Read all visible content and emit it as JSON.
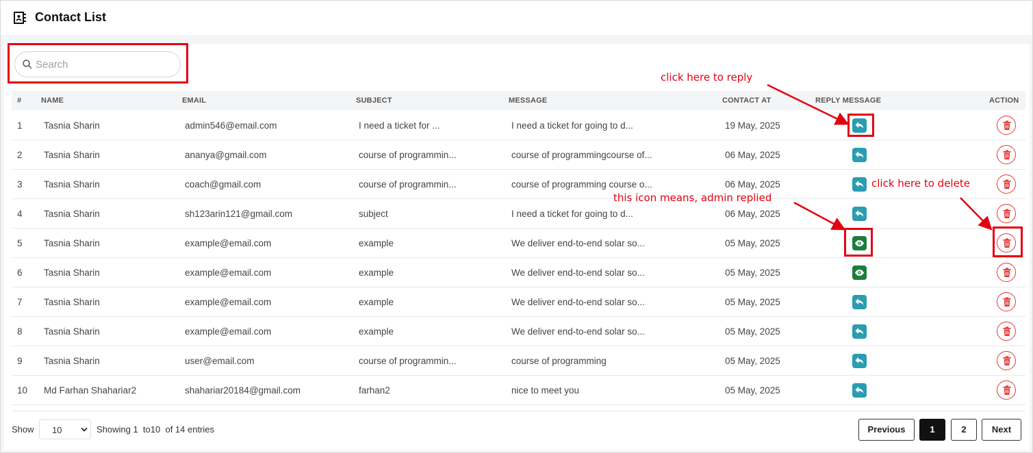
{
  "header": {
    "title": "Contact List",
    "icon": "address-book-icon"
  },
  "search": {
    "placeholder": "Search",
    "value": ""
  },
  "table": {
    "columns": {
      "index": "#",
      "name": "NAME",
      "email": "EMAIL",
      "subject": "SUBJECT",
      "message": "MESSAGE",
      "contact_at": "CONTACT AT",
      "reply": "REPLY MESSAGE",
      "action": "ACTION"
    },
    "rows": [
      {
        "index": "1",
        "name": "Tasnia Sharin",
        "email": "admin546@email.com",
        "subject": "I need a ticket for ...",
        "message": "I need a ticket for going to d...",
        "contact_at": "19 May, 2025",
        "replied": false
      },
      {
        "index": "2",
        "name": "Tasnia Sharin",
        "email": "ananya@gmail.com",
        "subject": "course of programmin...",
        "message": "course of programmingcourse of...",
        "contact_at": "06 May, 2025",
        "replied": false
      },
      {
        "index": "3",
        "name": "Tasnia Sharin",
        "email": "coach@gmail.com",
        "subject": "course of programmin...",
        "message": "course of programming course o...",
        "contact_at": "06 May, 2025",
        "replied": false
      },
      {
        "index": "4",
        "name": "Tasnia Sharin",
        "email": "sh123arin121@gmail.com",
        "subject": "subject",
        "message": "I need a ticket for going to d...",
        "contact_at": "06 May, 2025",
        "replied": false
      },
      {
        "index": "5",
        "name": "Tasnia Sharin",
        "email": "example@email.com",
        "subject": "example",
        "message": "We deliver end-to-end solar so...",
        "contact_at": "05 May, 2025",
        "replied": true
      },
      {
        "index": "6",
        "name": "Tasnia Sharin",
        "email": "example@email.com",
        "subject": "example",
        "message": "We deliver end-to-end solar so...",
        "contact_at": "05 May, 2025",
        "replied": true
      },
      {
        "index": "7",
        "name": "Tasnia Sharin",
        "email": "example@email.com",
        "subject": "example",
        "message": "We deliver end-to-end solar so...",
        "contact_at": "05 May, 2025",
        "replied": false
      },
      {
        "index": "8",
        "name": "Tasnia Sharin",
        "email": "example@email.com",
        "subject": "example",
        "message": "We deliver end-to-end solar so...",
        "contact_at": "05 May, 2025",
        "replied": false
      },
      {
        "index": "9",
        "name": "Tasnia Sharin",
        "email": "user@email.com",
        "subject": "course of programmin...",
        "message": "course of programming",
        "contact_at": "05 May, 2025",
        "replied": false
      },
      {
        "index": "10",
        "name": "Md Farhan Shahariar2",
        "email": "shahariar20184@gmail.com",
        "subject": "farhan2",
        "message": "nice to meet you",
        "contact_at": "05 May, 2025",
        "replied": false
      }
    ]
  },
  "footer": {
    "show_label": "Show",
    "page_size": "10",
    "entries_text": "Showing 1  to10  of 14 entries",
    "pagination": {
      "previous": "Previous",
      "pages": [
        "1",
        "2"
      ],
      "current": "1",
      "next": "Next"
    }
  },
  "annotations": {
    "reply": "click here to reply",
    "delete": "click here to delete",
    "replied": "this icon means, admin replied"
  },
  "colors": {
    "reply_button": "#2a9db0",
    "replied_button": "#1e7d3e",
    "delete_button": "#e53935",
    "annotation": "#e3000f"
  }
}
